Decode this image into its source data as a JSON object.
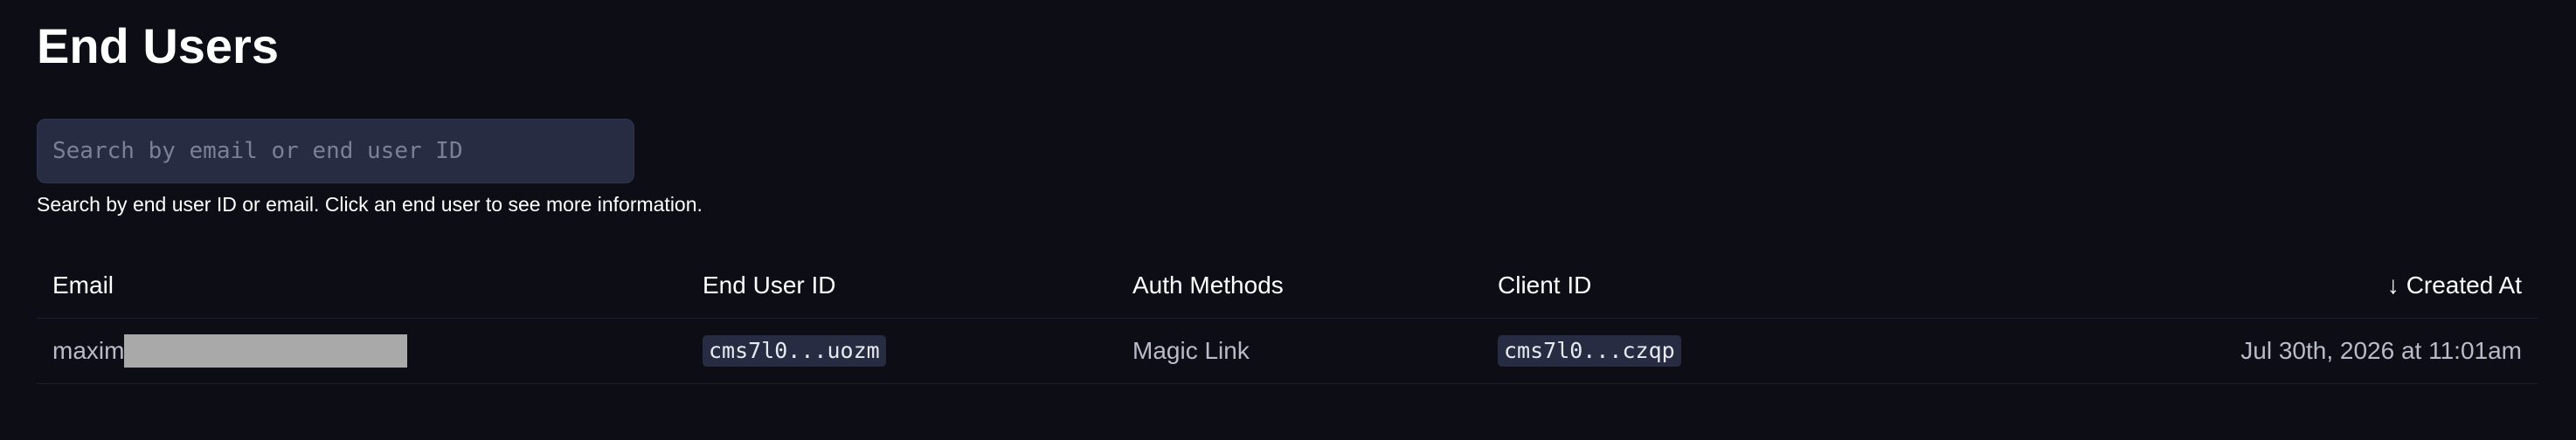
{
  "page": {
    "title": "End Users"
  },
  "search": {
    "placeholder": "Search by email or end user ID",
    "value": "",
    "hint": "Search by end user ID or email. Click an end user to see more information."
  },
  "table": {
    "columns": {
      "email": "Email",
      "end_user_id": "End User ID",
      "auth_methods": "Auth Methods",
      "client_id": "Client ID",
      "created_at": "Created At",
      "sort_indicator": "↓"
    },
    "rows": [
      {
        "email_visible": "maxim",
        "end_user_id": "cms7l0...uozm",
        "auth_methods": "Magic Link",
        "client_id": "cms7l0...czqp",
        "created_at": "Jul 30th, 2026 at 11:01am"
      }
    ]
  },
  "colors": {
    "background": "#0c0d15",
    "input_background": "#272c43",
    "muted_text": "#b8bcc8",
    "redaction": "#a9a9a9"
  }
}
